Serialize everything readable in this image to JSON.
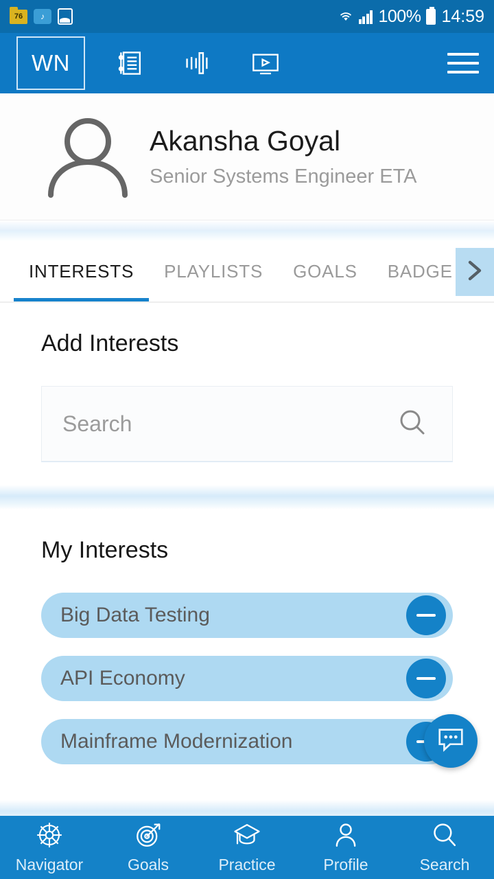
{
  "status_bar": {
    "notif_badge": "76",
    "notif_icons": [
      "folder-badge-icon",
      "cloud-file-icon",
      "gallery-icon"
    ],
    "wifi_icon": "wifi-icon",
    "signal_icon": "cellular-signal-icon",
    "battery_percent": "100%",
    "battery_icon": "battery-full-icon",
    "time": "14:59",
    "bg": "#0b6cab"
  },
  "toolbar": {
    "logo": "WN",
    "icons": [
      {
        "name": "articles-icon",
        "label": "Articles"
      },
      {
        "name": "audio-waveform-icon",
        "label": "Audio"
      },
      {
        "name": "video-player-icon",
        "label": "Video"
      }
    ],
    "menu_label": "Menu",
    "bg": "#0e79c4"
  },
  "profile": {
    "avatar_icon": "person-avatar-icon",
    "name": "Akansha Goyal",
    "role": "Senior Systems Engineer  ETA"
  },
  "tabs": {
    "items": [
      {
        "label": "INTERESTS",
        "active": true
      },
      {
        "label": "PLAYLISTS",
        "active": false
      },
      {
        "label": "GOALS",
        "active": false
      },
      {
        "label": "BADGE",
        "active": false
      }
    ],
    "more_icon": "chevron-right-icon",
    "active_color": "#1682cc",
    "more_bg": "#b8dcf2"
  },
  "add_interests": {
    "title": "Add Interests",
    "search_placeholder": "Search",
    "search_value": "",
    "search_icon": "search-icon"
  },
  "my_interests": {
    "title": "My Interests",
    "chip_bg": "#aed9f2",
    "chip_btn_bg": "#1482c8",
    "items": [
      {
        "label": "Big Data Testing",
        "action_icon": "minus-icon"
      },
      {
        "label": "API Economy",
        "action_icon": "minus-icon"
      },
      {
        "label": "Mainframe Modernization",
        "action_icon": "minus-icon"
      }
    ]
  },
  "fab": {
    "icon": "chat-bubble-icon",
    "label": "Chat",
    "bg": "#1482c8"
  },
  "bottom_nav": {
    "bg": "#1482c8",
    "items": [
      {
        "label": "Navigator",
        "icon": "ship-wheel-icon"
      },
      {
        "label": "Goals",
        "icon": "target-arrow-icon"
      },
      {
        "label": "Practice",
        "icon": "graduation-cap-icon"
      },
      {
        "label": "Profile",
        "icon": "person-icon"
      },
      {
        "label": "Search",
        "icon": "search-icon"
      }
    ]
  }
}
